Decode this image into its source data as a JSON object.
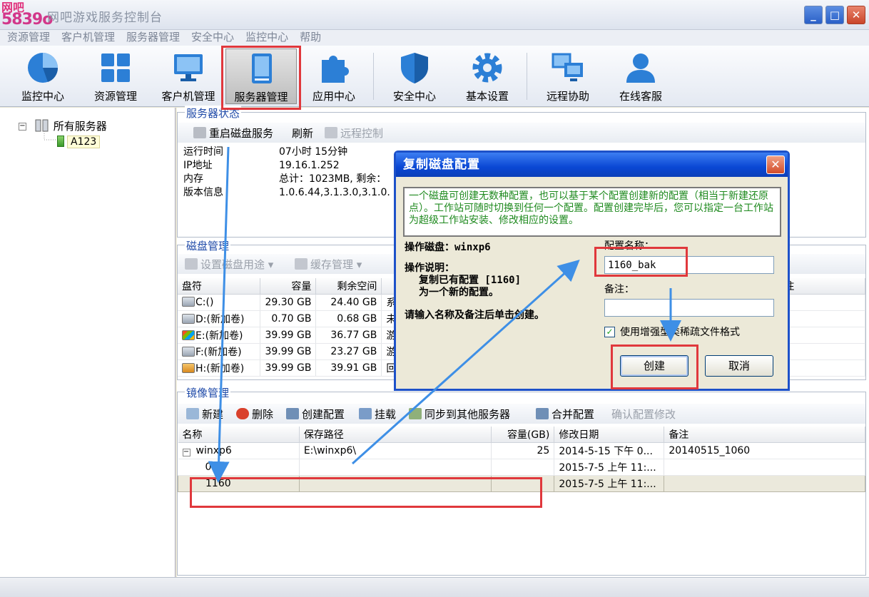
{
  "window": {
    "title": "网吧游戏服务控制台",
    "logo_top": "网吧",
    "logo_bottom": "5839o",
    "min_symbol": "_",
    "max_symbol": "□",
    "close_symbol": "✕"
  },
  "menu": [
    "资源管理",
    "客户机管理",
    "服务器管理",
    "安全中心",
    "监控中心",
    "帮助"
  ],
  "toolbar": [
    {
      "label": "监控中心",
      "icon": "pie-chart-icon"
    },
    {
      "label": "资源管理",
      "icon": "grid-icon"
    },
    {
      "label": "客户机管理",
      "icon": "monitor-icon"
    },
    {
      "label": "服务器管理",
      "icon": "server-icon"
    },
    {
      "label": "应用中心",
      "icon": "puzzle-icon"
    },
    {
      "label": "安全中心",
      "icon": "shield-icon"
    },
    {
      "label": "基本设置",
      "icon": "gear-icon"
    },
    {
      "label": "远程协助",
      "icon": "remote-screens-icon"
    },
    {
      "label": "在线客服",
      "icon": "user-support-icon"
    }
  ],
  "tree": {
    "root": "所有服务器",
    "child": "A123",
    "expand_symbol": "−"
  },
  "server_status": {
    "title": "服务器状态",
    "actions": [
      "重启磁盘服务",
      "刷新",
      "远程控制"
    ],
    "rows": [
      {
        "label": "运行时间",
        "value": "07小时 15分钟"
      },
      {
        "label": "IP地址",
        "value": "19.16.1.252"
      },
      {
        "label": "内存",
        "value": "总计：1023MB, 剩余："
      },
      {
        "label": "版本信息",
        "value": "1.0.6.44,3.1.3.0,3.1.0."
      }
    ]
  },
  "disk_mgmt": {
    "title": "磁盘管理",
    "actions": [
      "设置磁盘用途",
      "缓存管理"
    ],
    "columns": [
      "盘符",
      "容量",
      "剩余空间",
      "备注"
    ],
    "rows": [
      {
        "drive": "C:()",
        "size": "29.30 GB",
        "free": "24.40 GB",
        "extra": "系"
      },
      {
        "drive": "D:(新加卷)",
        "size": "0.70 GB",
        "free": "0.68 GB",
        "extra": "未"
      },
      {
        "drive": "E:(新加卷)",
        "size": "39.99 GB",
        "free": "36.77 GB",
        "extra": "游"
      },
      {
        "drive": "F:(新加卷)",
        "size": "39.99 GB",
        "free": "23.27 GB",
        "extra": "游"
      },
      {
        "drive": "H:(新加卷)",
        "size": "39.99 GB",
        "free": "39.91 GB",
        "extra": "回"
      }
    ]
  },
  "image_mgmt": {
    "title": "镜像管理",
    "actions": [
      "新建",
      "删除",
      "创建配置",
      "挂载",
      "同步到其他服务器",
      "合并配置",
      "确认配置修改"
    ],
    "columns": [
      "名称",
      "保存路径",
      "容量(GB)",
      "修改日期",
      "备注"
    ],
    "rows": [
      {
        "name": "winxp6",
        "path": "E:\\winxp6\\",
        "size": "25",
        "date": "2014-5-15 下午 0...",
        "note": "20140515_1060"
      },
      {
        "name": "001",
        "path": "",
        "size": "",
        "date": "2015-7-5 上午 11:...",
        "note": ""
      },
      {
        "name": "1160",
        "path": "",
        "size": "",
        "date": "2015-7-5 上午 11:...",
        "note": ""
      }
    ]
  },
  "dialog": {
    "title": "复制磁盘配置",
    "close_symbol": "✕",
    "hint": "一个磁盘可创建无数种配置，也可以基于某个配置创建新的配置（相当于新建还原点）。工作站可随时切换到任何一个配置。配置创建完毕后，您可以指定一台工作站为超级工作站安装、修改相应的设置。",
    "disk_label": "操作磁盘：winxp6",
    "desc_label": "操作说明：",
    "desc_line1": "复制已有配置 [1160]",
    "desc_line2": "为一个新的配置。",
    "instruction": "请输入名称及备注后单击创建。",
    "name_label": "配置名称：",
    "name_value": "1160_bak",
    "note_label": "备注：",
    "note_value": "",
    "checkbox_label": "使用增强型类稀疏文件格式",
    "checkbox_checked": "✓",
    "create_button": "创建",
    "cancel_button": "取消"
  },
  "colors": {
    "accent": "#1d51c9",
    "highlight": "#e0383c",
    "arrow": "#3e8fe6"
  }
}
